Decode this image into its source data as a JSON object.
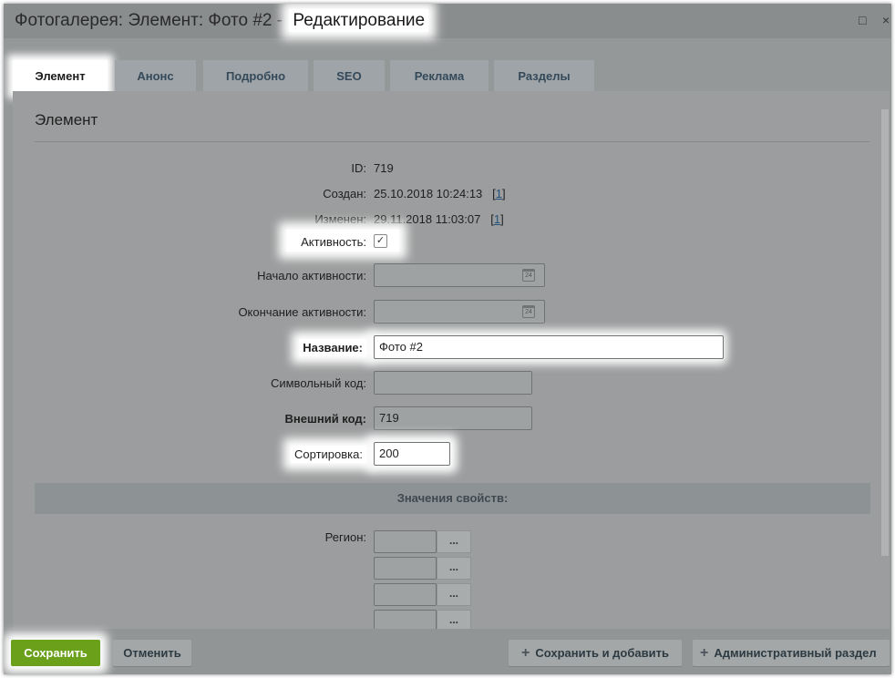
{
  "window": {
    "title_main": "Фотогалерея: Элемент: Фото #2 - ",
    "title_highlight": "Редактирование",
    "maximize_icon": "□",
    "close_icon": "×"
  },
  "tabs": [
    {
      "label": "Элемент",
      "active": true
    },
    {
      "label": "Анонс"
    },
    {
      "label": "Подробно"
    },
    {
      "label": "SEO"
    },
    {
      "label": "Реклама"
    },
    {
      "label": "Разделы"
    }
  ],
  "section_title": "Элемент",
  "fields": {
    "id": {
      "label": "ID:",
      "value": "719"
    },
    "created": {
      "label": "Создан:",
      "value": "25.10.2018 10:24:13",
      "link_open": "[",
      "link": "1",
      "link_close": "]"
    },
    "modified": {
      "label": "Изменен:",
      "value": "29.11.2018 11:03:07",
      "link_open": "[",
      "link": "1",
      "link_close": "]"
    },
    "active": {
      "label": "Активность:",
      "checked": true,
      "check_glyph": "✓"
    },
    "active_from": {
      "label": "Начало активности:",
      "value": "",
      "calendar_text": "24"
    },
    "active_to": {
      "label": "Окончание активности:",
      "value": "",
      "calendar_text": "24"
    },
    "name": {
      "label": "Название:",
      "value": "Фото #2"
    },
    "code": {
      "label": "Символьный код:",
      "value": ""
    },
    "external_code": {
      "label": "Внешний код:",
      "value": "719"
    },
    "sort": {
      "label": "Сортировка:",
      "value": "200"
    }
  },
  "properties": {
    "header": "Значения свойств:",
    "region_label": "Регион:",
    "region_button": "..."
  },
  "footer": {
    "save": "Сохранить",
    "cancel": "Отменить",
    "save_add": "Сохранить и добавить",
    "admin_section": "Административный раздел",
    "plus": "+"
  },
  "colors": {
    "save_button": "#6aa01a",
    "link": "#23527c",
    "overlay": "#959899"
  }
}
